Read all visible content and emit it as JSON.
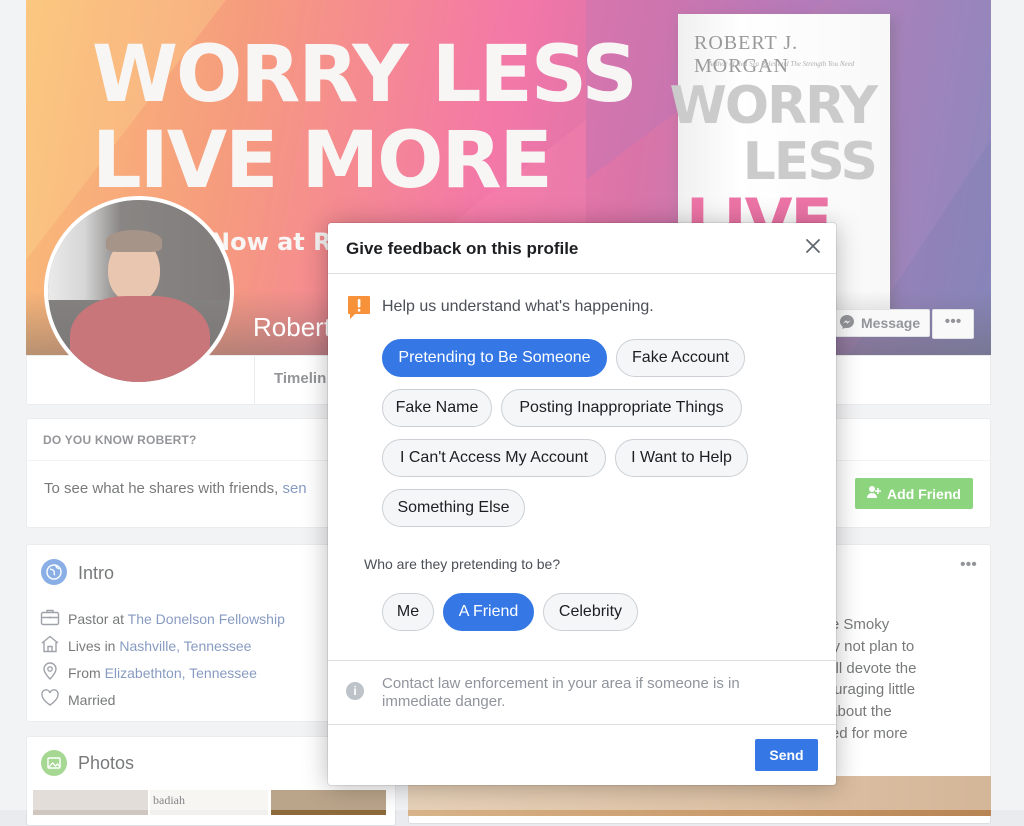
{
  "cover": {
    "headline": "WORRY LESS\nLIVE MORE",
    "sub": "Now at Rob",
    "book_author": "ROBERT J. MORGAN",
    "book_subtitle": "Author of Red Sea Rules and The Strength You Need",
    "book_worry": "WORRY\nLESS",
    "book_live": "LIVE\n  RE"
  },
  "profile": {
    "name": "Robert",
    "message_label": "Message",
    "more_label": "•••",
    "tab_timeline": "Timelin"
  },
  "know": {
    "heading": "DO YOU KNOW ROBERT?",
    "text": "To see what he shares with friends, ",
    "link": "sen",
    "add_friend_label": "Add Friend"
  },
  "intro": {
    "title": "Intro",
    "items": [
      {
        "prefix": "Pastor at ",
        "link": "The Donelson Fellowship",
        "icon": "briefcase-icon"
      },
      {
        "prefix": "Lives in ",
        "link": "Nashville, Tennessee",
        "icon": "home-icon"
      },
      {
        "prefix": "From ",
        "link": "Elizabethton, Tennessee",
        "icon": "location-pin-icon"
      },
      {
        "prefix": "Married",
        "link": "",
        "icon": "heart-icon"
      }
    ]
  },
  "photos": {
    "title": "Photos",
    "thumb_text": "badiah"
  },
  "post": {
    "lines": [
      "t the Smoky",
      "Why not plan to",
      "We’ll devote the",
      "ncouraging little",
      "ys about the",
      "tuned for more"
    ],
    "more_label": "•••"
  },
  "dialog": {
    "title": "Give feedback on this profile",
    "hint": "Help us understand what's happening.",
    "options": [
      {
        "label": "Pretending to Be Someone",
        "selected": true
      },
      {
        "label": "Fake Account",
        "selected": false
      },
      {
        "label": "Fake Name",
        "selected": false
      },
      {
        "label": "Posting Inappropriate Things",
        "selected": false
      },
      {
        "label": "I Can't Access My Account",
        "selected": false
      },
      {
        "label": "I Want to Help",
        "selected": false
      },
      {
        "label": "Something Else",
        "selected": false
      }
    ],
    "question": "Who are they pretending to be?",
    "sub_options": [
      {
        "label": "Me",
        "selected": false
      },
      {
        "label": "A Friend",
        "selected": true
      },
      {
        "label": "Celebrity",
        "selected": false
      }
    ],
    "info": "Contact law enforcement in your area if someone is in immediate danger.",
    "send_label": "Send"
  },
  "colors": {
    "accent": "#3578e5",
    "add_friend": "#42b72a",
    "link": "#385898",
    "warning": "#f7923b"
  }
}
